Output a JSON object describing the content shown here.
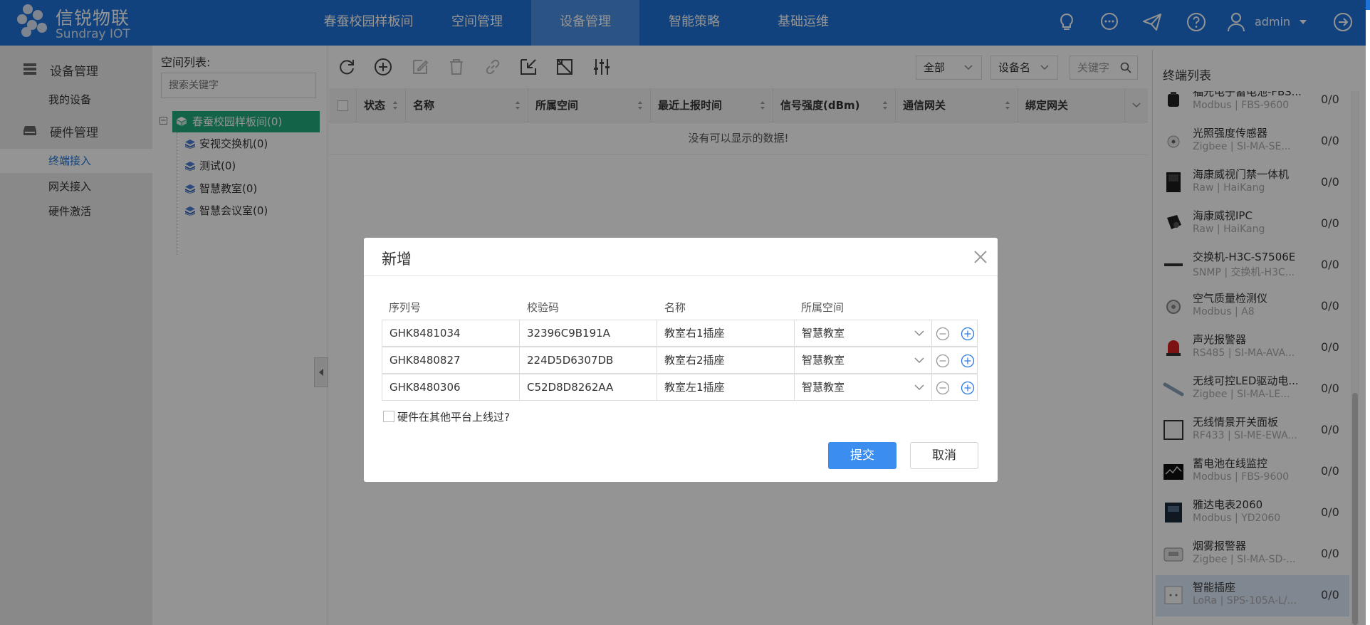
{
  "header": {
    "logo_title": "信锐物联",
    "logo_sub": "Sundray IOT",
    "tabs": [
      {
        "label": "春蚕校园样板间"
      },
      {
        "label": "空间管理"
      },
      {
        "label": "设备管理"
      },
      {
        "label": "智能策略"
      },
      {
        "label": "基础运维"
      }
    ],
    "active_tab": "设备管理",
    "user": "admin"
  },
  "sidebar": {
    "groups": [
      {
        "label": "设备管理",
        "items": [
          {
            "label": "我的设备"
          }
        ]
      },
      {
        "label": "硬件管理",
        "items": [
          {
            "label": "终端接入"
          },
          {
            "label": "网关接入"
          },
          {
            "label": "硬件激活"
          }
        ]
      }
    ],
    "active_item": "终端接入"
  },
  "space": {
    "title": "空间列表:",
    "search_placeholder": "搜索关键字",
    "root": "春蚕校园样板间(0)",
    "children": [
      {
        "label": "安视交换机(0)"
      },
      {
        "label": "测试(0)"
      },
      {
        "label": "智慧教室(0)"
      },
      {
        "label": "智慧会议室(0)"
      }
    ]
  },
  "toolbar": {
    "filter_scope": "全部",
    "filter_field": "设备名",
    "keyword_placeholder": "关键字"
  },
  "table": {
    "columns": [
      "状态",
      "名称",
      "所属空间",
      "最近上报时间",
      "信号强度(dBm)",
      "通信网关",
      "绑定网关"
    ],
    "empty_text": "没有可以显示的数据!"
  },
  "terminal_list": {
    "title": "终端列表",
    "items": [
      {
        "name": "福光电子蓄电池-FBS...",
        "sub": "Modbus | FBS-9600",
        "count": "0/0"
      },
      {
        "name": "光照强度传感器",
        "sub": "Zigbee | SI-MA-SE...",
        "count": "0/0"
      },
      {
        "name": "海康威视门禁一体机",
        "sub": "Raw | HaiKang",
        "count": "0/0"
      },
      {
        "name": "海康威视IPC",
        "sub": "Raw | HaiKang",
        "count": "0/0"
      },
      {
        "name": "交换机-H3C-S7506E",
        "sub": "SNMP | 交换机-H3C...",
        "count": "0/0"
      },
      {
        "name": "空气质量检测仪",
        "sub": "Modbus | A8",
        "count": "0/0"
      },
      {
        "name": "声光报警器",
        "sub": "RS485 | SI-MA-AVA...",
        "count": "0/0"
      },
      {
        "name": "无线可控LED驱动电...",
        "sub": "Zigbee | SI-MA-LE...",
        "count": "0/0"
      },
      {
        "name": "无线情景开关面板",
        "sub": "RF433 | SI-ME-EWA...",
        "count": "0/0"
      },
      {
        "name": "蓄电池在线监控",
        "sub": "Modbus | FBS-9600",
        "count": "0/0"
      },
      {
        "name": "雅达电表2060",
        "sub": "Modbus | YD2060",
        "count": "0/0"
      },
      {
        "name": "烟雾报警器",
        "sub": "Zigbee | SI-MA-SD-...",
        "count": "0/0"
      },
      {
        "name": "智能插座",
        "sub": "LoRa | SPS-105A-L/...",
        "count": "0/0"
      }
    ],
    "selected": "智能插座"
  },
  "modal": {
    "title": "新增",
    "columns": [
      "序列号",
      "校验码",
      "名称",
      "所属空间"
    ],
    "rows": [
      {
        "serial": "GHK8481034",
        "code": "32396C9B191A",
        "name": "教室右1插座",
        "space": "智慧教室"
      },
      {
        "serial": "GHK8480827",
        "code": "224D5D6307DB",
        "name": "教室右2插座",
        "space": "智慧教室"
      },
      {
        "serial": "GHK8480306",
        "code": "C52D8D8262AA",
        "name": "教室左1插座",
        "space": "智慧教室"
      }
    ],
    "checkbox_label": "硬件在其他平台上线过?",
    "submit_label": "提交",
    "cancel_label": "取消"
  },
  "colors": {
    "brand": "#1e73d8",
    "tree_active": "#1fab7a",
    "submit": "#3b8ef0"
  }
}
